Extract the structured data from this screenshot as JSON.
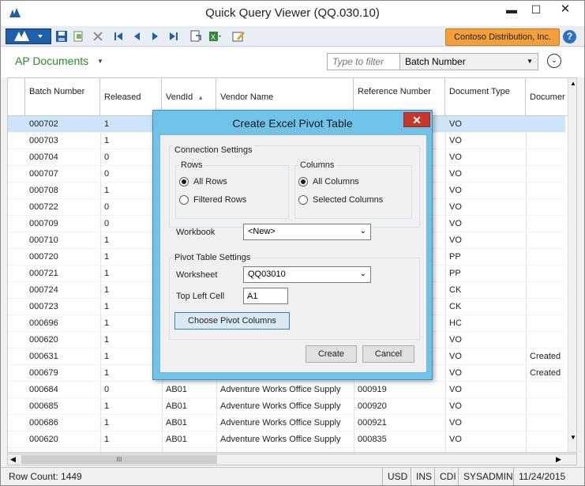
{
  "window": {
    "title": "Quick Query Viewer (QQ.030.10)",
    "min_glyph": "▬",
    "max_glyph": "☐",
    "close_glyph": "✕"
  },
  "toolbar": {
    "company": "Contoso Distribution, Inc.",
    "help_glyph": "?"
  },
  "query": {
    "name": "AP Documents",
    "caret": "▼",
    "filter_placeholder": "Type to filter",
    "filter_column": "Batch Number",
    "dd_glyph": "▼",
    "expand_glyph": "⌄"
  },
  "grid": {
    "columns": [
      {
        "label": "Batch Number"
      },
      {
        "label": "Released"
      },
      {
        "label": "VendId"
      },
      {
        "label": "Vendor Name"
      },
      {
        "label": "Reference Number"
      },
      {
        "label": "Document Type"
      },
      {
        "label": "Documer"
      }
    ],
    "rows": [
      [
        "000702",
        "1",
        "",
        "",
        "",
        "VO",
        ""
      ],
      [
        "000703",
        "1",
        "",
        "",
        "",
        "VO",
        ""
      ],
      [
        "000704",
        "0",
        "",
        "",
        "",
        "VO",
        ""
      ],
      [
        "000707",
        "0",
        "",
        "",
        "",
        "VO",
        ""
      ],
      [
        "000708",
        "1",
        "",
        "",
        "",
        "VO",
        ""
      ],
      [
        "000722",
        "0",
        "",
        "",
        "",
        "VO",
        ""
      ],
      [
        "000709",
        "0",
        "",
        "",
        "",
        "VO",
        ""
      ],
      [
        "000710",
        "1",
        "",
        "",
        "",
        "VO",
        ""
      ],
      [
        "000720",
        "1",
        "",
        "",
        "",
        "PP",
        ""
      ],
      [
        "000721",
        "1",
        "",
        "",
        "",
        "PP",
        ""
      ],
      [
        "000724",
        "1",
        "",
        "",
        "",
        "CK",
        ""
      ],
      [
        "000723",
        "1",
        "",
        "",
        "",
        "CK",
        ""
      ],
      [
        "000696",
        "1",
        "",
        "",
        "",
        "HC",
        ""
      ],
      [
        "000620",
        "1",
        "",
        "",
        "",
        "VO",
        ""
      ],
      [
        "000631",
        "1",
        "",
        "",
        "",
        "VO",
        "Created"
      ],
      [
        "000679",
        "1",
        "",
        "",
        "",
        "VO",
        "Created"
      ],
      [
        "000684",
        "0",
        "AB01",
        "Adventure Works Office Supply",
        "000919",
        "VO",
        ""
      ],
      [
        "000685",
        "1",
        "AB01",
        "Adventure Works Office Supply",
        "000920",
        "VO",
        ""
      ],
      [
        "000686",
        "1",
        "AB01",
        "Adventure Works Office Supply",
        "000921",
        "VO",
        ""
      ],
      [
        "000620",
        "1",
        "AB01",
        "Adventure Works Office Supply",
        "000835",
        "VO",
        ""
      ]
    ]
  },
  "scroll": {
    "thumb_glyph": "III",
    "left": "◀",
    "right": "▶",
    "up": "▲",
    "down": "▼"
  },
  "status": {
    "row_count": "Row Count: 1449",
    "currency": "USD",
    "ins": "INS",
    "cdi": "CDI",
    "user": "SYSADMIN",
    "date": "11/24/2015"
  },
  "dialog": {
    "title": "Create Excel Pivot Table",
    "close_glyph": "✕",
    "connection_settings": "Connection Settings",
    "rows_label": "Rows",
    "all_rows": "All Rows",
    "filtered_rows": "Filtered Rows",
    "columns_label": "Columns",
    "all_columns": "All Columns",
    "selected_columns": "Selected Columns",
    "workbook_label": "Workbook",
    "workbook_value": "<New>",
    "pivot_settings": "Pivot Table Settings",
    "worksheet_label": "Worksheet",
    "worksheet_value": "QQ03010",
    "top_left_label": "Top Left Cell",
    "top_left_value": "A1",
    "choose_columns": "Choose Pivot Columns",
    "create": "Create",
    "cancel": "Cancel",
    "dd_glyph": "⌄"
  }
}
